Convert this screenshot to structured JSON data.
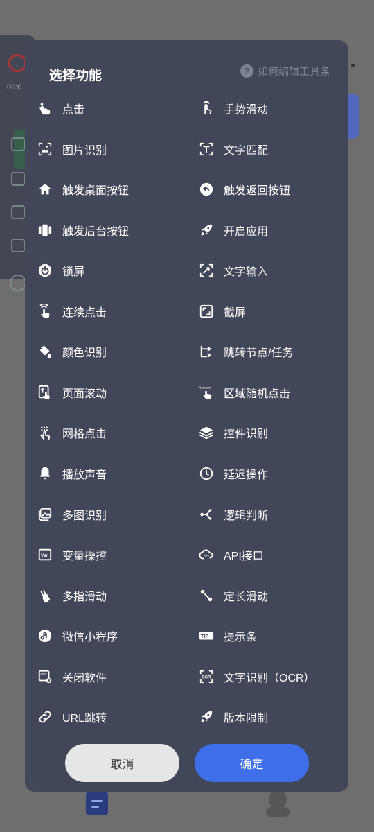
{
  "background": {
    "recording_time": "00:0"
  },
  "dialog": {
    "title": "选择功能",
    "help_text": "如何编辑工具条",
    "items": [
      {
        "label": "点击",
        "icon": "tap-icon"
      },
      {
        "label": "手势滑动",
        "icon": "swipe-gesture-icon"
      },
      {
        "label": "图片识别",
        "icon": "image-recognition-icon"
      },
      {
        "label": "文字匹配",
        "icon": "text-match-icon"
      },
      {
        "label": "触发桌面按钮",
        "icon": "home-icon"
      },
      {
        "label": "触发返回按钮",
        "icon": "back-icon"
      },
      {
        "label": "触发后台按钮",
        "icon": "recent-apps-icon"
      },
      {
        "label": "开启应用",
        "icon": "rocket-icon"
      },
      {
        "label": "锁屏",
        "icon": "power-icon"
      },
      {
        "label": "文字输入",
        "icon": "text-input-icon"
      },
      {
        "label": "连续点击",
        "icon": "multi-tap-icon"
      },
      {
        "label": "截屏",
        "icon": "screenshot-icon"
      },
      {
        "label": "颜色识别",
        "icon": "paint-bucket-icon"
      },
      {
        "label": "跳转节点/任务",
        "icon": "jump-node-icon"
      },
      {
        "label": "页面滚动",
        "icon": "page-scroll-icon"
      },
      {
        "label": "区域随机点击",
        "icon": "random-tap-icon"
      },
      {
        "label": "网格点击",
        "icon": "grid-tap-icon"
      },
      {
        "label": "控件识别",
        "icon": "layers-icon"
      },
      {
        "label": "播放声音",
        "icon": "bell-icon"
      },
      {
        "label": "延迟操作",
        "icon": "clock-icon"
      },
      {
        "label": "多图识别",
        "icon": "multi-image-icon"
      },
      {
        "label": "逻辑判断",
        "icon": "logic-branch-icon"
      },
      {
        "label": "变量操控",
        "icon": "variable-icon"
      },
      {
        "label": "API接口",
        "icon": "api-cloud-icon"
      },
      {
        "label": "多指滑动",
        "icon": "multi-finger-swipe-icon"
      },
      {
        "label": "定长滑动",
        "icon": "fixed-swipe-icon"
      },
      {
        "label": "微信小程序",
        "icon": "mini-program-icon"
      },
      {
        "label": "提示条",
        "icon": "tip-icon"
      },
      {
        "label": "关闭软件",
        "icon": "close-app-icon"
      },
      {
        "label": "文字识别（OCR）",
        "icon": "ocr-icon"
      },
      {
        "label": "URL跳转",
        "icon": "link-icon"
      },
      {
        "label": "版本限制",
        "icon": "rocket-icon"
      }
    ],
    "cancel_label": "取消",
    "confirm_label": "确定"
  },
  "colors": {
    "dialog_bg": "#414759",
    "confirm_bg": "#3f6fe8",
    "cancel_bg": "#e6e6e6",
    "overlay": "#6e6e6e"
  }
}
